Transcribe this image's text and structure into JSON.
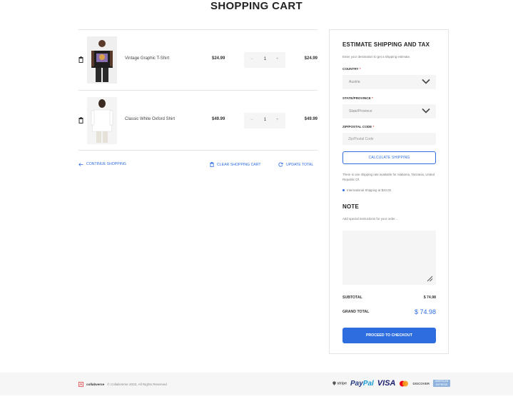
{
  "page": {
    "title": "SHOPPING CART"
  },
  "cart": {
    "items": [
      {
        "name": "Vintage Graphic T-Shirt",
        "price": "$24.99",
        "qty": "1",
        "total": "$24.99",
        "image_icon": "tshirt-photo"
      },
      {
        "name": "Classic White Oxford Shirt",
        "price": "$49.99",
        "qty": "1",
        "total": "$49.99",
        "image_icon": "oxford-shirt-photo"
      }
    ],
    "qty_minus": "−",
    "qty_plus": "+",
    "actions": {
      "continue": "CONTINUE SHOPPING",
      "clear": "CLEAR SHOPPING CART",
      "update": "UPDATE TOTAL"
    }
  },
  "shipping": {
    "title": "ESTIMATE SHIPPING AND TAX",
    "subtitle": "Enter your destination to get a shipping estimate.",
    "country_label": "COUNTRY",
    "country_value": "Austria",
    "state_label": "STATE/PROVINCE",
    "state_value": "State/Province",
    "zip_label": "ZIP/POSTAL CODE",
    "zip_placeholder": "Zip/Postal Code",
    "required_mark": "*",
    "calc_button": "CALCULATE SHIPPING",
    "rate_note": "There is one shipping rate available for Alabama, Tanzania, United Republic Of.",
    "rate_item": "International Shipping at $20.00"
  },
  "note": {
    "title": "NOTE",
    "subtitle": "Add special instructions for your order..."
  },
  "summary": {
    "subtotal_label": "SUBTOTAL",
    "subtotal_value": "$ 74.98",
    "grand_label": "GRAND TOTAL",
    "grand_value": "$ 74.98",
    "checkout": "PROCEED TO CHECKOUT"
  },
  "footer": {
    "brand": "collabverse",
    "copyright": "© CollabVerse 2023, All Rights Reserved",
    "payments": {
      "stripe": "stripe",
      "paypal_a": "Pay",
      "paypal_b": "Pal",
      "visa": "VISA",
      "discover": "DISCOVER",
      "amex": "AMERICAN EXPRESS"
    }
  },
  "colors": {
    "accent": "#2e6de0",
    "required": "#e04848",
    "footer_bg": "#f6f6f6"
  }
}
